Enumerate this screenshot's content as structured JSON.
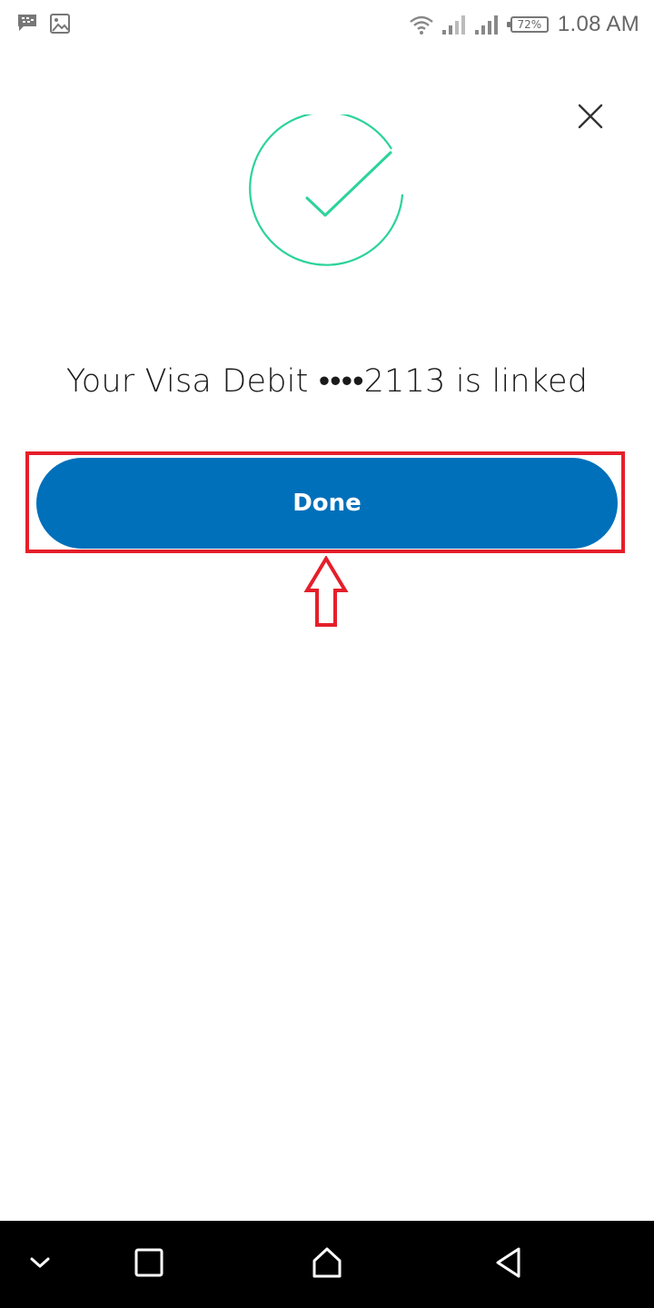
{
  "status_bar": {
    "battery_percent": "72%",
    "time": "1.08 AM",
    "left_icons": [
      "bbm-icon",
      "image-icon"
    ],
    "right_icons": [
      "wifi-icon",
      "signal-icon-1",
      "signal-icon-2",
      "battery-icon"
    ]
  },
  "dialog": {
    "close_icon": "close-icon",
    "success_icon": "check-circle-icon",
    "message": "Your Visa Debit ••••2113 is linked",
    "done_label": "Done"
  },
  "colors": {
    "primary_button": "#0070ba",
    "success_green": "#2bd39a",
    "highlight_red": "#e51f2a",
    "nav_bar": "#000000"
  },
  "nav_bar": {
    "buttons": [
      "chevron-down-icon",
      "recents-icon",
      "home-icon",
      "back-icon"
    ]
  }
}
